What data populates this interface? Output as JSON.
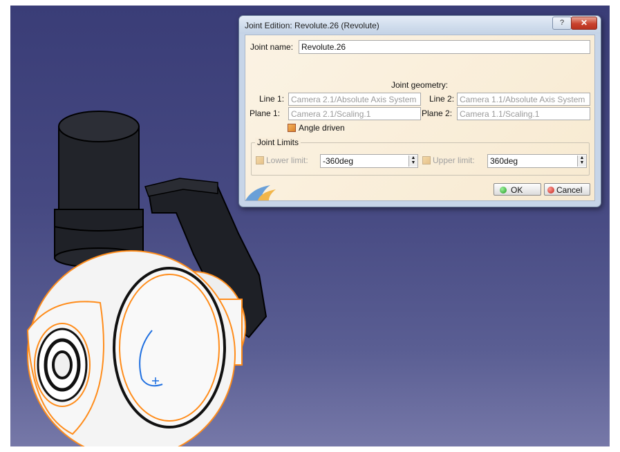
{
  "dialog": {
    "title": "Joint Edition: Revolute.26 (Revolute)",
    "help_glyph": "?",
    "close_glyph": "✕",
    "joint_name_label": "Joint name:",
    "joint_name_value": "Revolute.26",
    "geometry_header": "Joint geometry:",
    "line1_label": "Line 1:",
    "line1_value": "Camera 2.1/Absolute Axis System",
    "line2_label": "Line 2:",
    "line2_value": "Camera 1.1/Absolute Axis System",
    "plane1_label": "Plane 1:",
    "plane1_value": "Camera 2.1/Scaling.1",
    "plane2_label": "Plane 2:",
    "plane2_value": "Camera 1.1/Scaling.1",
    "angle_driven_label": "Angle driven",
    "limits_header": "Joint Limits",
    "lower_limit_label": "Lower limit:",
    "lower_limit_value": "-360deg",
    "upper_limit_label": "Upper limit:",
    "upper_limit_value": "360deg",
    "ok_label": "OK",
    "cancel_label": "Cancel"
  },
  "colors": {
    "viewport_bg": "#464982",
    "highlight": "#ff8c1a",
    "ok_dot": "#2db52d",
    "cancel_dot": "#d8342a"
  }
}
